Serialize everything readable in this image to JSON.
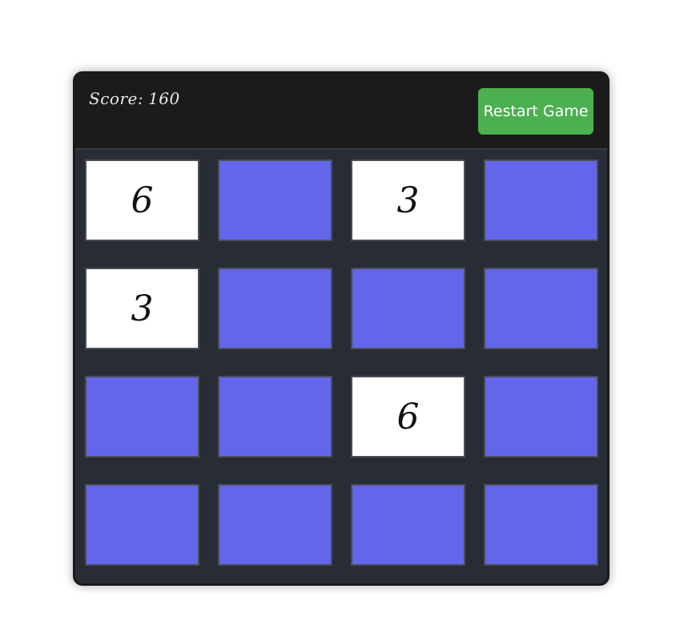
{
  "header": {
    "score_label": "Score:",
    "score_value": "160",
    "restart_label": "Restart Game"
  },
  "colors": {
    "hidden_tile": "#6366ea",
    "revealed_tile": "#ffffff",
    "restart_button": "#4caf50",
    "board_background": "#282c34",
    "header_background": "#1b1b1b"
  },
  "board": {
    "rows": [
      [
        {
          "revealed": true,
          "value": "6"
        },
        {
          "revealed": false,
          "value": ""
        },
        {
          "revealed": true,
          "value": "3"
        },
        {
          "revealed": false,
          "value": ""
        }
      ],
      [
        {
          "revealed": true,
          "value": "3"
        },
        {
          "revealed": false,
          "value": ""
        },
        {
          "revealed": false,
          "value": ""
        },
        {
          "revealed": false,
          "value": ""
        }
      ],
      [
        {
          "revealed": false,
          "value": ""
        },
        {
          "revealed": false,
          "value": ""
        },
        {
          "revealed": true,
          "value": "6"
        },
        {
          "revealed": false,
          "value": ""
        }
      ],
      [
        {
          "revealed": false,
          "value": ""
        },
        {
          "revealed": false,
          "value": ""
        },
        {
          "revealed": false,
          "value": ""
        },
        {
          "revealed": false,
          "value": ""
        }
      ]
    ]
  }
}
